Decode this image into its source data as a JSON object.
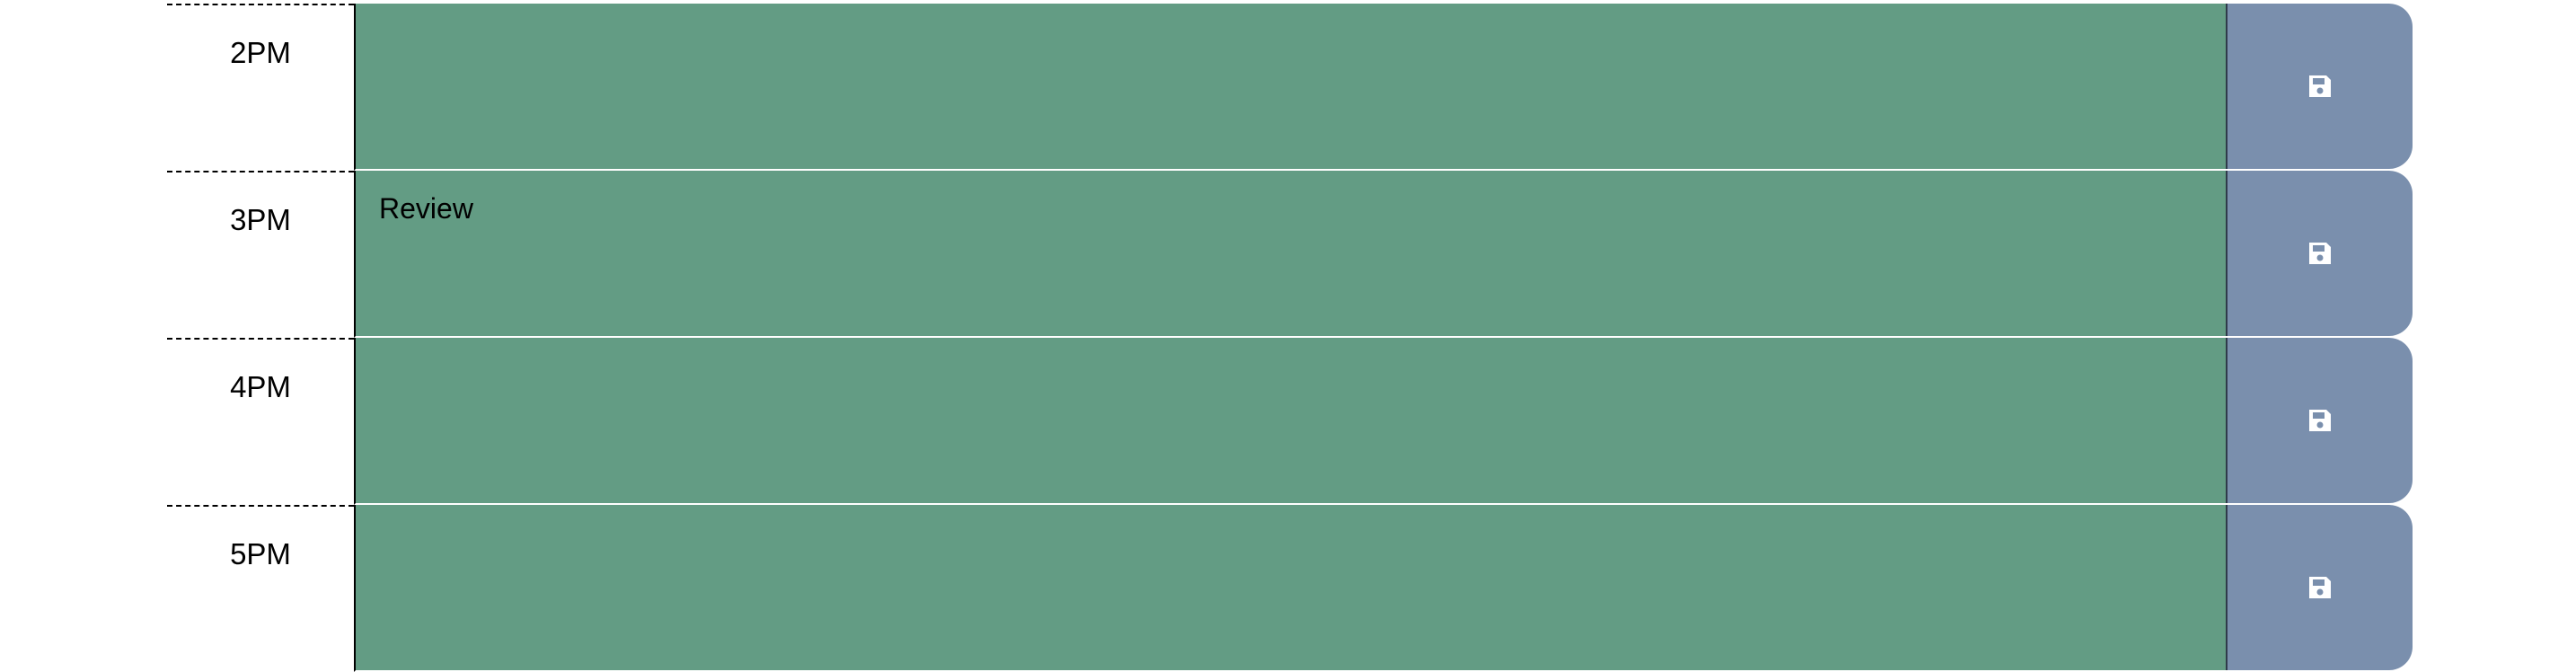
{
  "colors": {
    "event_background": "#639c84",
    "save_background": "#7a8fad",
    "icon": "#ffffff"
  },
  "rows": [
    {
      "hour": "2PM",
      "event": "",
      "save_icon": "floppy-disk-icon"
    },
    {
      "hour": "3PM",
      "event": "Review",
      "save_icon": "floppy-disk-icon"
    },
    {
      "hour": "4PM",
      "event": "",
      "save_icon": "floppy-disk-icon"
    },
    {
      "hour": "5PM",
      "event": "",
      "save_icon": "floppy-disk-icon"
    }
  ]
}
